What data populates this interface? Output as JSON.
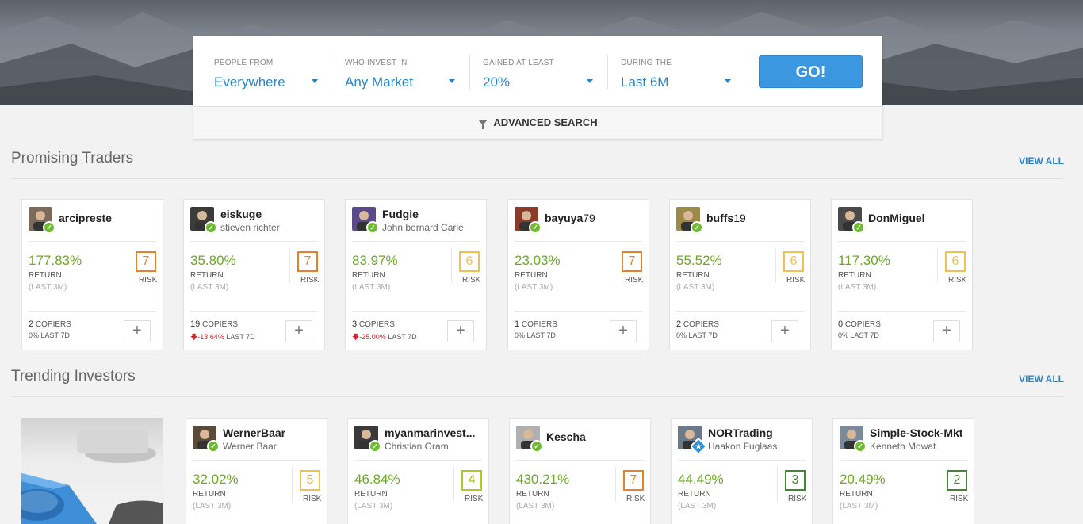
{
  "search": {
    "filters": [
      {
        "label": "PEOPLE FROM",
        "value": "Everywhere"
      },
      {
        "label": "WHO INVEST IN",
        "value": "Any Market"
      },
      {
        "label": "GAINED AT LEAST",
        "value": "20%"
      },
      {
        "label": "DURING THE",
        "value": "Last 6M"
      }
    ],
    "go_label": "GO!",
    "advanced_label": "ADVANCED SEARCH"
  },
  "promising": {
    "title": "Promising Traders",
    "view_all": "VIEW ALL",
    "cards": [
      {
        "username": "arcipreste",
        "username_suffix": "",
        "fullname": "",
        "return": "177.83%",
        "return_label": "RETURN",
        "period": "(LAST 3M)",
        "risk": "7",
        "risk_label": "RISK",
        "copiers_count": "2",
        "copiers_label": "COPIERS",
        "change": "0%",
        "change_label": "LAST 7D",
        "avatar_color": "#7a6b5a"
      },
      {
        "username": "eiskuge",
        "username_suffix": "",
        "fullname": "stieven richter",
        "return": "35.80%",
        "return_label": "RETURN",
        "period": "(LAST 3M)",
        "risk": "7",
        "risk_label": "RISK",
        "copiers_count": "19",
        "copiers_label": "COPIERS",
        "change": "-13.64%",
        "change_label": "LAST 7D",
        "avatar_color": "#3c3c3c"
      },
      {
        "username": "Fudgie",
        "username_suffix": "",
        "fullname": "John bernard Carle",
        "return": "83.97%",
        "return_label": "RETURN",
        "period": "(LAST 3M)",
        "risk": "6",
        "risk_label": "RISK",
        "copiers_count": "3",
        "copiers_label": "COPIERS",
        "change": "-25.00%",
        "change_label": "LAST 7D",
        "avatar_color": "#5a4a8a"
      },
      {
        "username": "bayuya",
        "username_suffix": "79",
        "fullname": "",
        "return": "23.03%",
        "return_label": "RETURN",
        "period": "(LAST 3M)",
        "risk": "7",
        "risk_label": "RISK",
        "copiers_count": "1",
        "copiers_label": "COPIERS",
        "change": "0%",
        "change_label": "LAST 7D",
        "avatar_color": "#8a3b2c"
      },
      {
        "username": "buffs",
        "username_suffix": "19",
        "fullname": "",
        "return": "55.52%",
        "return_label": "RETURN",
        "period": "(LAST 3M)",
        "risk": "6",
        "risk_label": "RISK",
        "copiers_count": "2",
        "copiers_label": "COPIERS",
        "change": "0%",
        "change_label": "LAST 7D",
        "avatar_color": "#9c8a4a"
      },
      {
        "username": "DonMiguel",
        "username_suffix": "",
        "fullname": "",
        "return": "117.30%",
        "return_label": "RETURN",
        "period": "(LAST 3M)",
        "risk": "6",
        "risk_label": "RISK",
        "copiers_count": "0",
        "copiers_label": "COPIERS",
        "change": "0%",
        "change_label": "LAST 7D",
        "avatar_color": "#4a4a4a"
      }
    ]
  },
  "trending": {
    "title": "Trending Investors",
    "view_all": "VIEW ALL",
    "cards": [
      {
        "username": "WernerBaar",
        "fullname": "Werner Baar",
        "return": "32.02%",
        "return_label": "RETURN",
        "period": "(LAST 3M)",
        "risk": "5",
        "risk_label": "RISK",
        "avatar_color": "#5c4a3a"
      },
      {
        "username": "myanmarinvest...",
        "fullname": "Christian Oram",
        "return": "46.84%",
        "return_label": "RETURN",
        "period": "(LAST 3M)",
        "risk": "4",
        "risk_label": "RISK",
        "avatar_color": "#3a3a3a"
      },
      {
        "username": "Kescha",
        "fullname": "",
        "return": "430.21%",
        "return_label": "RETURN",
        "period": "(LAST 3M)",
        "risk": "7",
        "risk_label": "RISK",
        "avatar_color": "#b0b0b0"
      },
      {
        "username": "NORTrading",
        "fullname": "Haakon Fuglaas",
        "return": "44.49%",
        "return_label": "RETURN",
        "period": "(LAST 3M)",
        "risk": "3",
        "risk_label": "RISK",
        "avatar_color": "#6a7a8a"
      },
      {
        "username": "Simple-Stock-Mkt",
        "fullname": "Kenneth Mowat",
        "return": "20.49%",
        "return_label": "RETURN",
        "period": "(LAST 3M)",
        "risk": "2",
        "risk_label": "RISK",
        "avatar_color": "#7a8a9a"
      }
    ]
  }
}
